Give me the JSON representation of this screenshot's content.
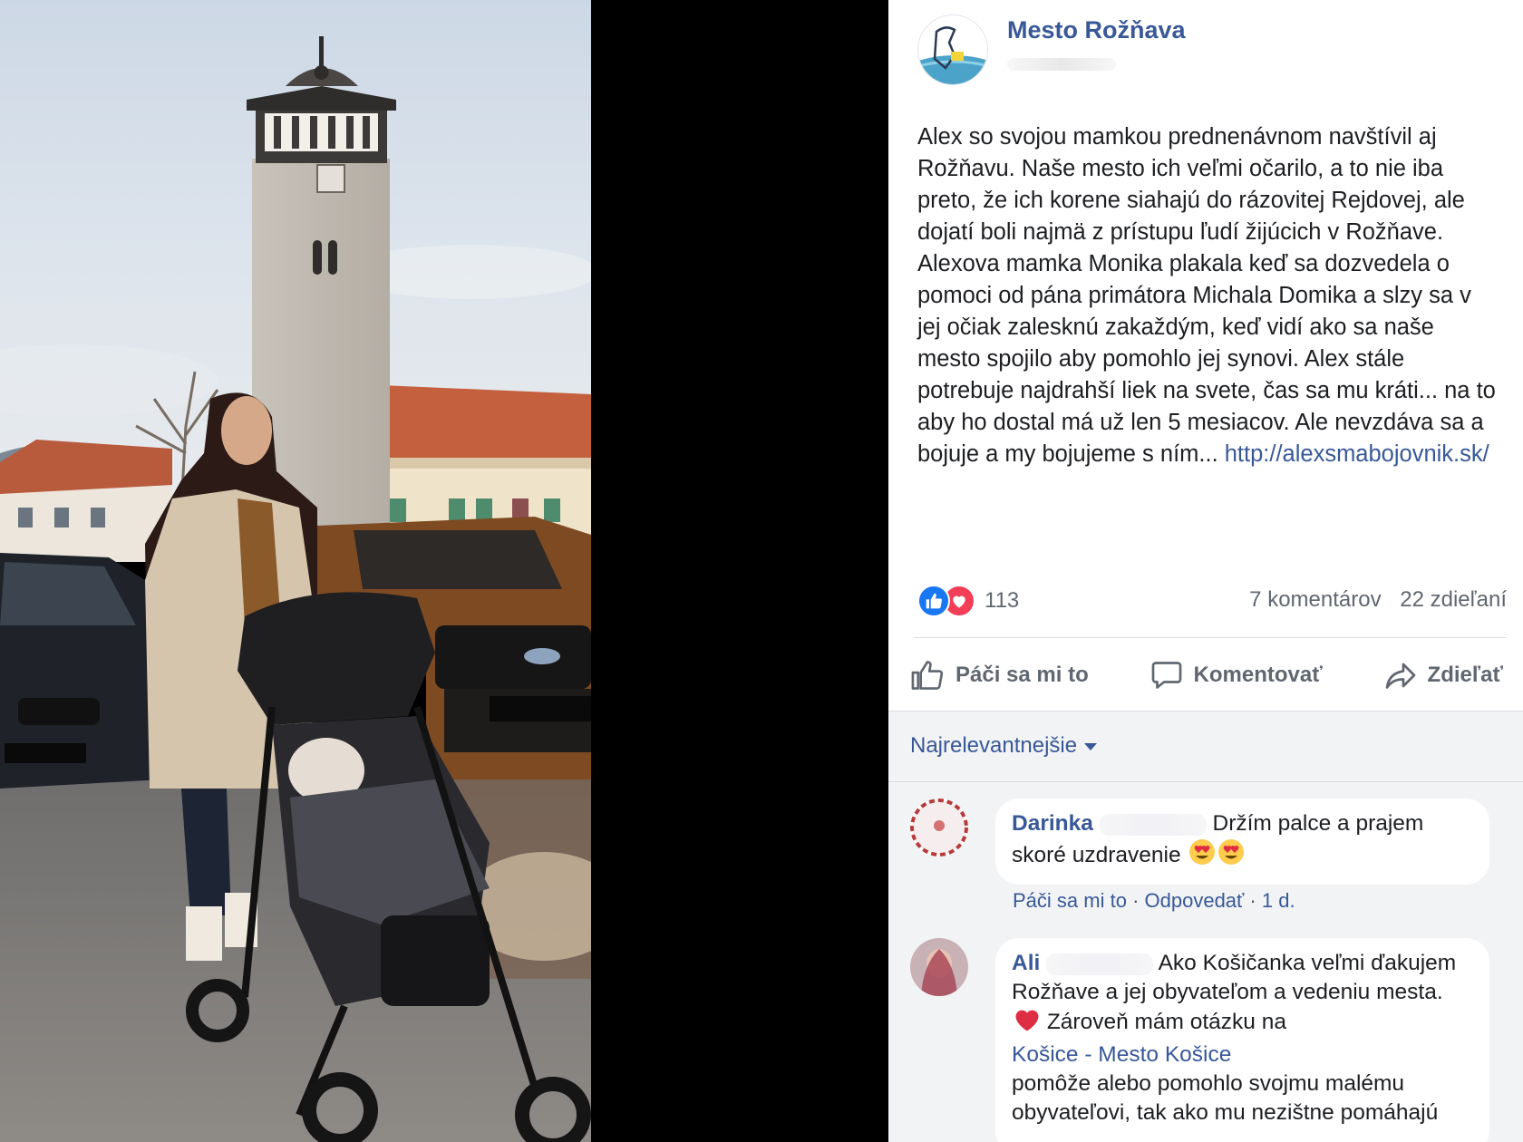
{
  "post": {
    "page_name": "Mesto Rožňava",
    "text": "Alex so svojou mamkou prednenávnom navštívil aj Rožňavu. Naše mesto ich veľmi očarilo, a to nie iba preto, že ich korene siahajú do rázovitej Rejdovej, ale dojatí boli najmä z prístupu ľudí žijúcich v Rožňave. Alexova mamka Monika plakala keď sa dozvedela o pomoci od pána primátora Michala Domika a slzy sa v jej očiak zalesknú zakaždým, keď vidí ako sa naše mesto spojilo aby pomohlo jej synovi. Alex stále potrebuje najdrahší liek na svete, čas sa mu kráti... na to aby ho dostal má už len 5 mesiacov. Ale nevzdáva sa a bojuje a my bojujeme s ním...",
    "link": "http://alexsmabojovnik.sk/",
    "reaction_count": "113",
    "comments_count": "7 komentárov",
    "shares_count": "22 zdieľaní"
  },
  "actions": {
    "like": "Páči sa mi to",
    "comment": "Komentovať",
    "share": "Zdieľať"
  },
  "sort_label": "Najrelevantnejšie",
  "comments": [
    {
      "author": "Darinka",
      "text": "Držím palce a prajem skoré uzdravenie",
      "like": "Páči sa mi to",
      "reply": "Odpovedať",
      "time": "1 d."
    },
    {
      "author": "Ali",
      "text_a": "Ako Košičanka veľmi ďakujem Rožňave a jej obyvateľom a vedeniu mesta.",
      "text_b": "Zároveň mám otázku na",
      "mention": "Košice - Mesto Košice",
      "text_c": "pomôže alebo pomohlo svojmu malému obyvateľovi, tak ako mu nezištne pomáhajú"
    }
  ],
  "icons": {
    "like": "thumbs-up-icon",
    "comment": "speech-bubble-icon",
    "share": "share-arrow-icon",
    "reaction_like": "like-reaction-icon",
    "reaction_love": "love-reaction-icon"
  },
  "colors": {
    "link": "#385898",
    "like_blue": "#1877f2",
    "love_red": "#f33e58",
    "muted": "#606770",
    "comments_bg": "#f2f3f5"
  }
}
